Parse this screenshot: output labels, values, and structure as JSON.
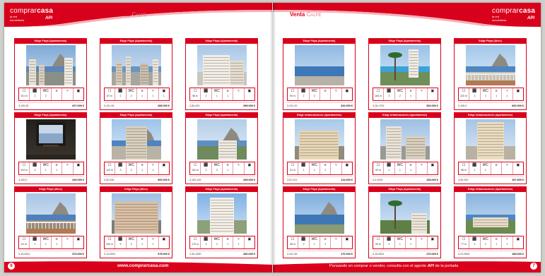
{
  "logo": {
    "brand_a": "comprar",
    "brand_b": "casa",
    "sub1": "la red",
    "sub2": "inmobiliaria",
    "api": "API"
  },
  "left_page": {
    "header": {
      "venta": "Venta",
      "city": "Calpe"
    },
    "footer": {
      "page_number": "6",
      "url": "www.comprarcasa.com"
    },
    "cards": [
      {
        "title": "Edige Playa (Apartamento)",
        "ref": "3-100-00",
        "price": "207.000 €",
        "features": [
          "101 m",
          "2",
          "2",
          "",
          "",
          ""
        ]
      },
      {
        "title": "Edige Playa (Apartamento)",
        "ref": "3-101-28",
        "price": "285.000 €",
        "features": [
          "87 m",
          "2",
          "2",
          "1",
          "1",
          "1"
        ]
      },
      {
        "title": "Edige Playa (Apartamento)",
        "ref": "3-56-329",
        "price": "395.000 €",
        "features": [
          "98 m",
          "2",
          "1",
          "1",
          "",
          ""
        ]
      },
      {
        "title": "Edige Playa (Apartamento)",
        "ref": "3-100-0",
        "price": "240.000 €",
        "features": [
          "104 m",
          "3",
          "1",
          "1",
          "",
          ""
        ]
      },
      {
        "title": "Edige Playa (Apartamento)",
        "ref": "3-90-336",
        "price": "300.000 €",
        "features": [
          "110 m",
          "3",
          "2",
          "1",
          "1",
          ""
        ]
      },
      {
        "title": "Edige Playa (Apartamento)",
        "ref": "3-100-109",
        "price": "265.000 €",
        "features": [
          "120 m",
          "3",
          "2",
          "1",
          "",
          ""
        ]
      },
      {
        "title": "Edige Playa (Ático)",
        "ref": "3-15-0001",
        "price": "373.000 €",
        "features": [
          "61 m",
          "2",
          "1",
          "1",
          "",
          ""
        ]
      },
      {
        "title": "Edige Playa (Ático)",
        "ref": "3-12-0001",
        "price": "375.000 €",
        "features": [
          "200 m",
          "3",
          "2",
          "1",
          "1",
          ""
        ]
      },
      {
        "title": "Edige Playa (Apartamento)",
        "ref": "3-30-1000",
        "price": "490.000 €",
        "features": [
          "170 m",
          "3",
          "2",
          "1",
          "1",
          ""
        ]
      }
    ]
  },
  "right_page": {
    "header": {
      "venta": "Venta",
      "city": "Calpe"
    },
    "footer": {
      "page_number": "7",
      "slogan_a": "Pensando en comprar o vender, consulta con el agente",
      "slogan_api": "API",
      "slogan_b": "de la portada"
    },
    "cards": [
      {
        "title": "Edige Playa (Apartamento)",
        "ref": "3-101-20",
        "price": "320.000 €",
        "features": [
          "90 m",
          "2",
          "2",
          "",
          "",
          ""
        ]
      },
      {
        "title": "Edige Playa (Apartamento)",
        "ref": "3-16-1700",
        "price": "330.000 €",
        "features": [
          "160 m",
          "3",
          "2",
          "1",
          "",
          ""
        ]
      },
      {
        "title": "Edige Playa (Ático)",
        "ref": "3-108-2",
        "price": "660.000 €",
        "features": [
          "220 m",
          "3",
          "2",
          "1",
          "1",
          ""
        ]
      },
      {
        "title": "Edige Urbanizaciones (Apartamento)",
        "ref": "3-57-013",
        "price": "114.000 €",
        "features": [
          "51 m",
          "1",
          "1",
          "1",
          "",
          ""
        ]
      },
      {
        "title": "Edige Urbanizaciones (Apartamento)",
        "ref": "3-2-2039",
        "price": "135.000 €",
        "features": [
          "92 m",
          "1",
          "1",
          "1",
          "",
          ""
        ]
      },
      {
        "title": "Edige Urbanizaciones (Apartamento)",
        "ref": "3-90-320",
        "price": "157.500 €",
        "features": [
          "58 m",
          "1",
          "1",
          "",
          "",
          ""
        ]
      },
      {
        "title": "Edige Playa (Apartamento)",
        "ref": "3-101-35",
        "price": "170.000 €",
        "features": [
          "58 m",
          "2",
          "1",
          "1",
          "",
          ""
        ]
      },
      {
        "title": "Edige Playa (Apartamento)",
        "ref": "3-15-0001",
        "price": "170.000 €",
        "features": [
          "90 m",
          "2",
          "1",
          "1",
          "",
          ""
        ]
      },
      {
        "title": "Edige Urbanizaciones (Apartamento)",
        "ref": "3-31-0000",
        "price": "185.000 €",
        "features": [
          "77 m",
          "2",
          "1",
          "1",
          "1",
          ""
        ]
      }
    ]
  },
  "feature_icons": [
    "size-icon",
    "bed-icon",
    "wc-icon",
    "terrace-icon",
    "pool-icon",
    "garage-icon"
  ],
  "feature_labels": [
    "",
    "",
    "WC",
    "",
    "",
    ""
  ],
  "colors": {
    "brand_red": "#d9001b"
  }
}
